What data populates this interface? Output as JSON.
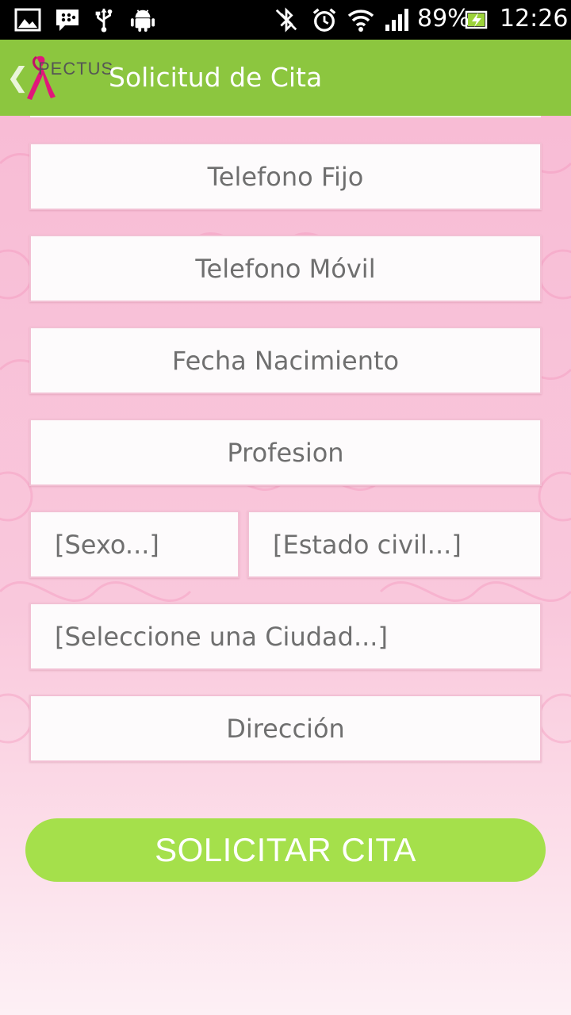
{
  "status_bar": {
    "battery": "89%",
    "time": "12:26"
  },
  "action_bar": {
    "logo_text": "PECTUS",
    "title": "Solicitud de Cita"
  },
  "form": {
    "telefono_fijo": "Telefono Fijo",
    "telefono_movil": "Telefono Móvil",
    "fecha_nacimiento": "Fecha Nacimiento",
    "profesion": "Profesion",
    "sexo": "[Sexo...]",
    "estado_civil": "[Estado civil...]",
    "ciudad": "[Seleccione una Ciudad...]",
    "direccion": "Dirección",
    "submit": "SOLICITAR CITA"
  },
  "colors": {
    "action_bar": "#8cc63f",
    "button": "#a5e04b",
    "background": "#f8bcd5",
    "ribbon": "#e0177a"
  }
}
